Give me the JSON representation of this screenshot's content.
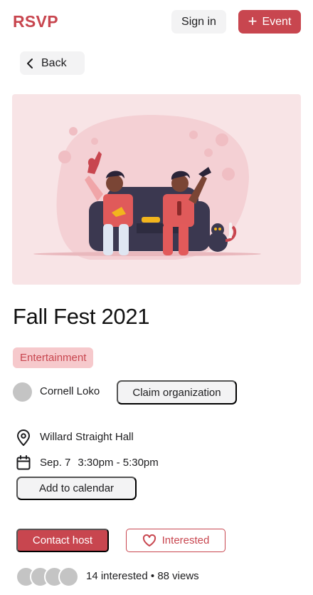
{
  "header": {
    "brand": "RSVP",
    "sign_in": "Sign in",
    "event_button": "Event"
  },
  "nav": {
    "back": "Back"
  },
  "event": {
    "title": "Fall Fest 2021",
    "category": "Entertainment",
    "organizer": "Cornell Loko",
    "claim_button": "Claim organization",
    "location": "Willard Straight Hall",
    "date": "Sep. 7",
    "time": "3:30pm - 5:30pm",
    "add_to_calendar": "Add to calendar"
  },
  "actions": {
    "contact_host": "Contact host",
    "interested": "Interested"
  },
  "stats": {
    "text": "14 interested • 88 views"
  },
  "colors": {
    "accent": "#c8464f",
    "tag_bg": "#f6c9cc",
    "hero_bg": "#f8e4e6",
    "button_gray": "#f3f3f4"
  },
  "icons": {
    "plus": "plus-icon",
    "back": "chevron-left-icon",
    "location": "map-pin-icon",
    "calendar": "calendar-icon",
    "heart": "heart-icon"
  }
}
